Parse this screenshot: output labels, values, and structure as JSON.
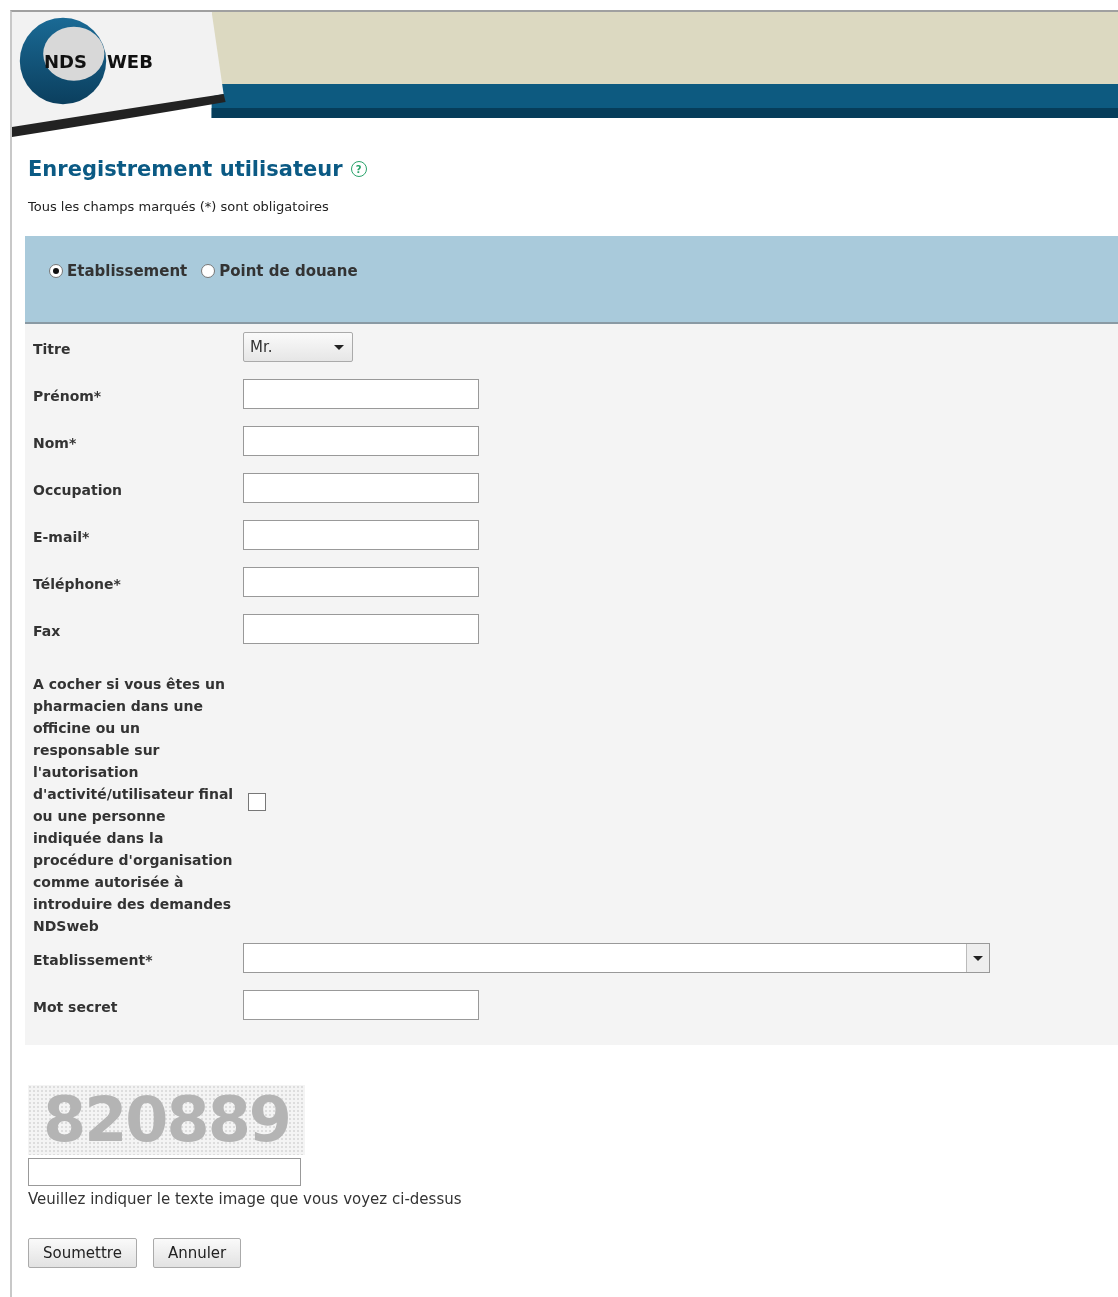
{
  "logo": {
    "part_1": "NDS",
    "part_2": "WEB"
  },
  "heading": {
    "title": "Enregistrement utilisateur",
    "help": "?"
  },
  "note": "Tous les champs marqués (*) sont obligatoires",
  "user_type": [
    {
      "label": "Etablissement",
      "selected": true
    },
    {
      "label": "Point de douane",
      "selected": false
    }
  ],
  "fields": [
    {
      "kind": "select",
      "label": "Titre",
      "value": "Mr."
    },
    {
      "kind": "text",
      "label": "Prénom*"
    },
    {
      "kind": "text",
      "label": "Nom*"
    },
    {
      "kind": "text",
      "label": "Occupation"
    },
    {
      "kind": "text",
      "label": "E-mail*"
    },
    {
      "kind": "text",
      "label": "Téléphone*"
    },
    {
      "kind": "text",
      "label": "Fax"
    },
    {
      "kind": "checkbox",
      "label": "A cocher si vous êtes un pharmacien dans une officine ou un responsable sur l'autorisation d'activité/utilisateur final ou une personne indiquée dans la procédure d'organisation comme autorisée à introduire des demandes NDSweb",
      "checked": false
    },
    {
      "kind": "wide_select",
      "label": "Etablissement*"
    },
    {
      "kind": "text",
      "label": "Mot secret"
    }
  ],
  "captcha": {
    "code": "820889",
    "instruction": "Veuillez indiquer le texte image que vous voyez ci-dessus"
  },
  "buttons": [
    "Soumettre",
    "Annuler"
  ]
}
